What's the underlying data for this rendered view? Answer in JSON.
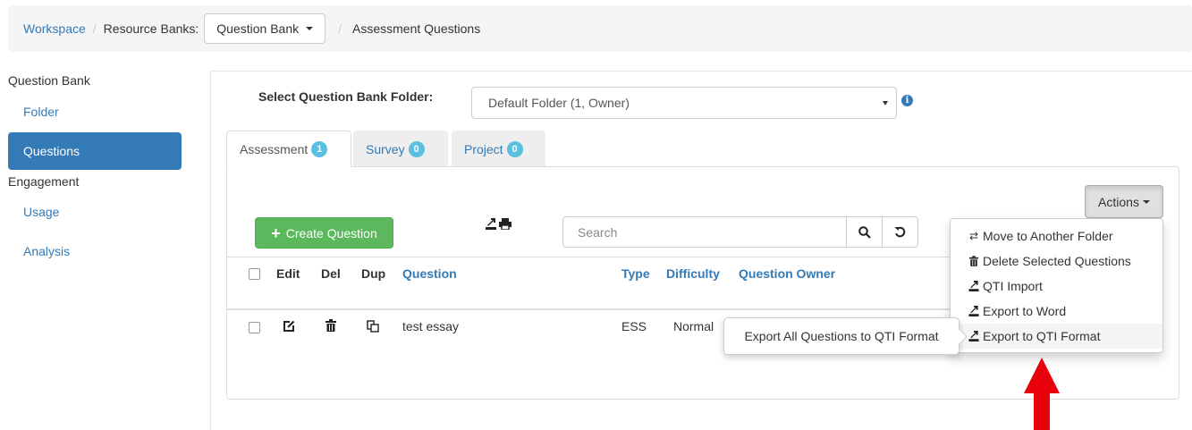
{
  "breadcrumb": {
    "workspace": "Workspace",
    "resource_banks": "Resource Banks",
    "colon": ":",
    "dropdown_label": "Question Bank",
    "current": "Assessment Questions",
    "separator": "/"
  },
  "sidebar": {
    "section1": "Question Bank",
    "folder": "Folder",
    "questions": "Questions",
    "section2": "Engagement",
    "usage": "Usage",
    "analysis": "Analysis"
  },
  "folder": {
    "label": "Select Question Bank Folder:",
    "selected": "Default Folder (1, Owner)",
    "info_icon": "info-circle-icon"
  },
  "tabs": [
    {
      "label": "Assessment",
      "count": "1"
    },
    {
      "label": "Survey",
      "count": "0"
    },
    {
      "label": "Project",
      "count": "0"
    }
  ],
  "toolbar": {
    "actions_label": "Actions",
    "create_label": "Create Question",
    "search_placeholder": "Search"
  },
  "table": {
    "headers": {
      "edit": "Edit",
      "del": "Del",
      "dup": "Dup",
      "question": "Question",
      "type": "Type",
      "difficulty": "Difficulty",
      "owner": "Question Owner"
    },
    "rows": [
      {
        "question": "test essay",
        "type": "ESS",
        "difficulty": "Normal"
      }
    ]
  },
  "menu": {
    "items": [
      {
        "label": "Move to Another Folder",
        "icon": "transfer-icon"
      },
      {
        "label": "Delete Selected Questions",
        "icon": "trash-icon"
      },
      {
        "label": "QTI Import",
        "icon": "import-icon"
      },
      {
        "label": "Export to Word",
        "icon": "export-icon"
      },
      {
        "label": "Export to QTI Format",
        "icon": "export-icon"
      }
    ]
  },
  "tooltip": {
    "text": "Export All Questions to QTI Format"
  },
  "colors": {
    "primary": "#337ab7",
    "success": "#5cb85c",
    "badge": "#5bc0de",
    "annotation_arrow": "#e8000b"
  }
}
